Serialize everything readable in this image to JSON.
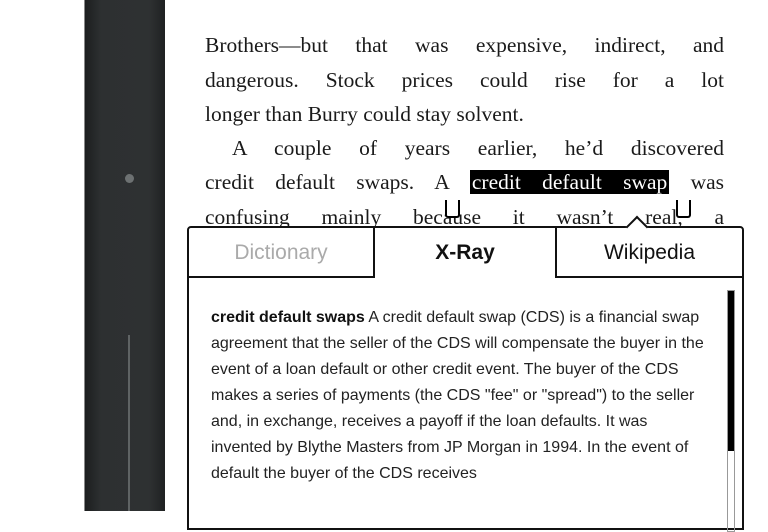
{
  "book": {
    "lines": [
      "Brothers—but that was expensive, indirect, and",
      "dangerous. Stock prices could rise for a lot",
      "longer than Burry could stay solvent.",
      "A couple of years earlier, he’d discovered"
    ],
    "line5_before": "credit default swaps. A ",
    "selection": "credit default swap",
    "line5_after": " was",
    "line6": "confusing mainly because it wasn’t real, a"
  },
  "popup": {
    "tabs": [
      {
        "label": "Dictionary",
        "state": "disabled"
      },
      {
        "label": "X-Ray",
        "state": "active"
      },
      {
        "label": "Wikipedia",
        "state": "inactive"
      }
    ],
    "term": "credit default swaps",
    "definition": " A credit default swap (CDS) is a financial swap agreement that the seller of the CDS will compensate the buyer in the event of a loan default or other credit event. The buyer of the CDS makes a series of payments (the CDS \"fee\" or \"spread\") to the seller and, in exchange, receives a payoff if the loan defaults. It was invented by Blythe Masters from JP Morgan in 1994. In the event of default the buyer of the CDS receives",
    "scroll_position_percent": 0
  }
}
